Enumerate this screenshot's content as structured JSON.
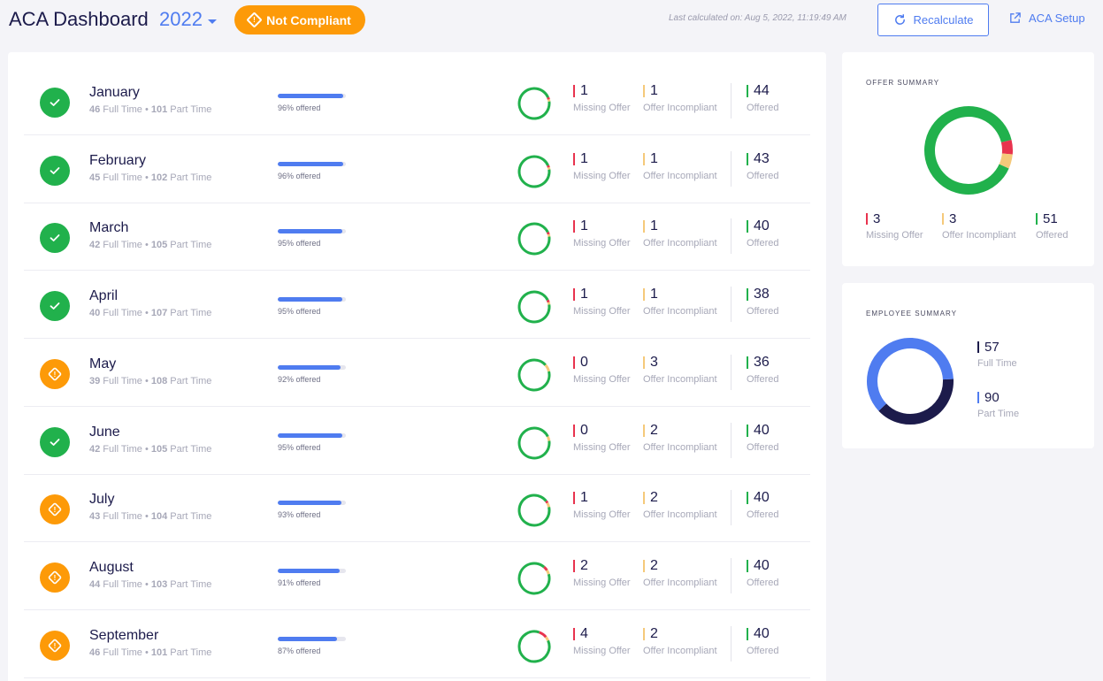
{
  "header": {
    "title": "ACA Dashboard",
    "year": "2022",
    "badge": "Not Compliant",
    "badge_symbol": "!",
    "last_calculated": "Last calculated on: Aug 5, 2022, 11:19:49 AM",
    "recalculate_label": "Recalculate",
    "setup_label": "ACA Setup"
  },
  "colors": {
    "brand_blue": "#4f7cf0",
    "ok_green": "#21b14c",
    "warn_orange": "#fd9a08",
    "missing_red": "#e8334e",
    "incompliant_yellow": "#f5c97a",
    "navy": "#1c1b4b"
  },
  "labels": {
    "full_time": "Full Time",
    "part_time": "Part Time",
    "bullet": "•",
    "missing_offer": "Missing Offer",
    "offer_incompliant": "Offer Incompliant",
    "offered": "Offered",
    "offered_suffix": "offered",
    "warn_symbol": "!"
  },
  "months": [
    {
      "name": "January",
      "status": "ok",
      "full_time": 46,
      "part_time": 101,
      "pct_offered": 96,
      "pct_label": "96% offered",
      "missing": 1,
      "incompliant": 1,
      "offered": 44
    },
    {
      "name": "February",
      "status": "ok",
      "full_time": 45,
      "part_time": 102,
      "pct_offered": 96,
      "pct_label": "96% offered",
      "missing": 1,
      "incompliant": 1,
      "offered": 43
    },
    {
      "name": "March",
      "status": "ok",
      "full_time": 42,
      "part_time": 105,
      "pct_offered": 95,
      "pct_label": "95% offered",
      "missing": 1,
      "incompliant": 1,
      "offered": 40
    },
    {
      "name": "April",
      "status": "ok",
      "full_time": 40,
      "part_time": 107,
      "pct_offered": 95,
      "pct_label": "95% offered",
      "missing": 1,
      "incompliant": 1,
      "offered": 38
    },
    {
      "name": "May",
      "status": "warn",
      "full_time": 39,
      "part_time": 108,
      "pct_offered": 92,
      "pct_label": "92% offered",
      "missing": 0,
      "incompliant": 3,
      "offered": 36
    },
    {
      "name": "June",
      "status": "ok",
      "full_time": 42,
      "part_time": 105,
      "pct_offered": 95,
      "pct_label": "95% offered",
      "missing": 0,
      "incompliant": 2,
      "offered": 40
    },
    {
      "name": "July",
      "status": "warn",
      "full_time": 43,
      "part_time": 104,
      "pct_offered": 93,
      "pct_label": "93% offered",
      "missing": 1,
      "incompliant": 2,
      "offered": 40
    },
    {
      "name": "August",
      "status": "warn",
      "full_time": 44,
      "part_time": 103,
      "pct_offered": 91,
      "pct_label": "91% offered",
      "missing": 2,
      "incompliant": 2,
      "offered": 40
    },
    {
      "name": "September",
      "status": "warn",
      "full_time": 46,
      "part_time": 101,
      "pct_offered": 87,
      "pct_label": "87% offered",
      "missing": 4,
      "incompliant": 2,
      "offered": 40
    }
  ],
  "offer_summary": {
    "title": "OFFER SUMMARY",
    "missing": 3,
    "incompliant": 3,
    "offered": 51
  },
  "employee_summary": {
    "title": "EMPLOYEE SUMMARY",
    "full_time": 57,
    "part_time": 90
  }
}
